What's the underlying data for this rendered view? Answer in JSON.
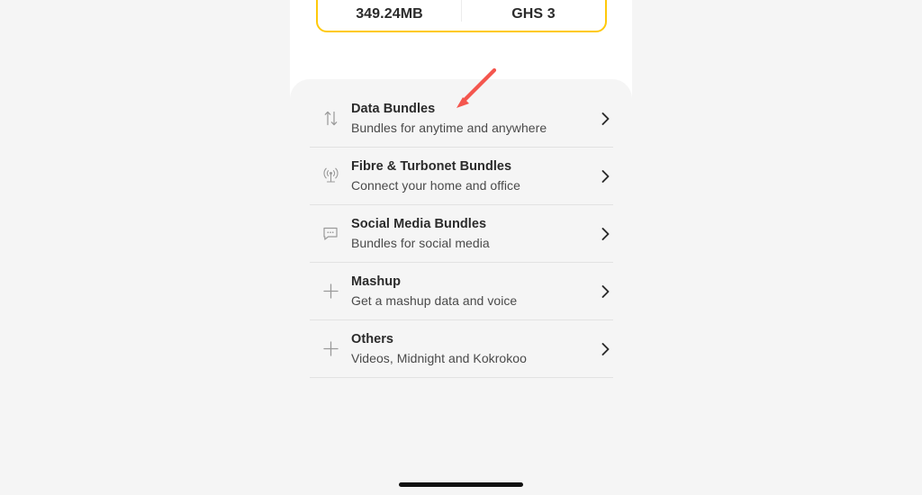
{
  "colors": {
    "page_background": "#f5f5f5",
    "phone_background": "#ffffff",
    "sheet_background": "#f5f5f5",
    "card_border_yellow": "#ffc90a",
    "title_text": "#2b2b2b",
    "subtitle_text": "#4a4a4a",
    "icon_gray": "#9a9a9a",
    "divider": "#e2e2e2",
    "annotation_red": "#f4564e",
    "home_indicator": "#111111"
  },
  "usage_card": {
    "cells": [
      {
        "value": "349.24MB"
      },
      {
        "value": "GHS 3"
      }
    ]
  },
  "bundles": {
    "items": [
      {
        "icon": "data-transfer-icon",
        "title": "Data Bundles",
        "subtitle": "Bundles for anytime and anywhere",
        "chevron": "chevron-right-icon"
      },
      {
        "icon": "broadcast-antenna-icon",
        "title": "Fibre & Turbonet Bundles",
        "subtitle": "Connect your home and office",
        "chevron": "chevron-right-icon"
      },
      {
        "icon": "chat-bubble-icon",
        "title": "Social Media Bundles",
        "subtitle": "Bundles for social media",
        "chevron": "chevron-right-icon"
      },
      {
        "icon": "plus-icon",
        "title": "Mashup",
        "subtitle": "Get a mashup data and voice",
        "chevron": "chevron-right-icon"
      },
      {
        "icon": "plus-icon",
        "title": "Others",
        "subtitle": "Videos, Midnight and Kokrokoo",
        "chevron": "chevron-right-icon"
      }
    ]
  },
  "annotation": {
    "type": "arrow",
    "direction": "down-left",
    "points_at": "Data Bundles"
  },
  "home_indicator": {
    "label": "home-indicator"
  }
}
